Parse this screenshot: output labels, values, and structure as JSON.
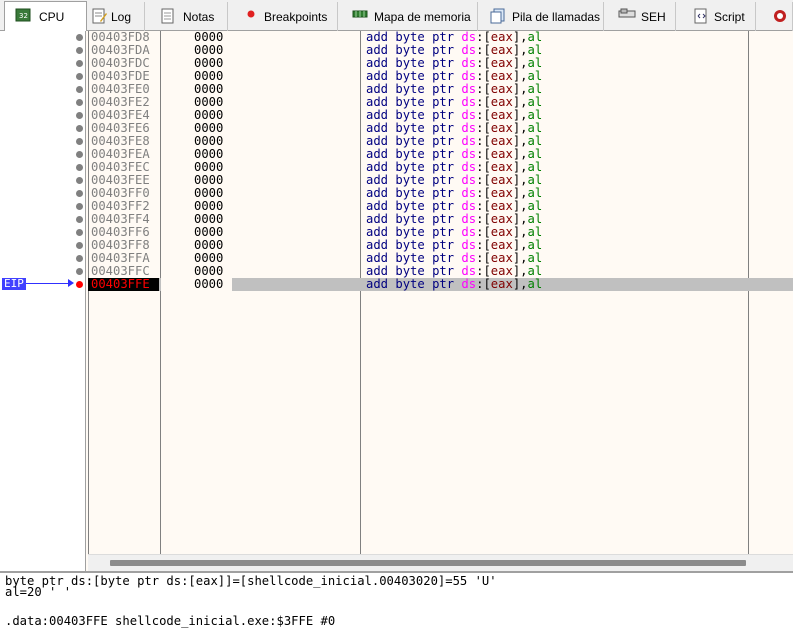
{
  "tabs": [
    {
      "label": "CPU",
      "icon": "cpu-icon",
      "active": true
    },
    {
      "label": "Log",
      "icon": "log-icon"
    },
    {
      "label": "Notas",
      "icon": "notes-icon"
    },
    {
      "label": "Breakpoints",
      "icon": "breakpoint-icon"
    },
    {
      "label": "Mapa de memoria",
      "icon": "memory-map-icon"
    },
    {
      "label": "Pila de llamadas",
      "icon": "call-stack-icon"
    },
    {
      "label": "SEH",
      "icon": "seh-icon"
    },
    {
      "label": "Script",
      "icon": "script-icon"
    }
  ],
  "eip_label": "EIP",
  "disasm": {
    "mnemonic": "add",
    "size": "byte",
    "ptr": "ptr",
    "segment": "ds",
    "reg_mem": "eax",
    "reg_src": "al",
    "rows": [
      {
        "address": "00403FD8",
        "bytes": "0000"
      },
      {
        "address": "00403FDA",
        "bytes": "0000"
      },
      {
        "address": "00403FDC",
        "bytes": "0000"
      },
      {
        "address": "00403FDE",
        "bytes": "0000"
      },
      {
        "address": "00403FE0",
        "bytes": "0000"
      },
      {
        "address": "00403FE2",
        "bytes": "0000"
      },
      {
        "address": "00403FE4",
        "bytes": "0000"
      },
      {
        "address": "00403FE6",
        "bytes": "0000"
      },
      {
        "address": "00403FE8",
        "bytes": "0000"
      },
      {
        "address": "00403FEA",
        "bytes": "0000"
      },
      {
        "address": "00403FEC",
        "bytes": "0000"
      },
      {
        "address": "00403FEE",
        "bytes": "0000"
      },
      {
        "address": "00403FF0",
        "bytes": "0000"
      },
      {
        "address": "00403FF2",
        "bytes": "0000"
      },
      {
        "address": "00403FF4",
        "bytes": "0000"
      },
      {
        "address": "00403FF6",
        "bytes": "0000"
      },
      {
        "address": "00403FF8",
        "bytes": "0000"
      },
      {
        "address": "00403FFA",
        "bytes": "0000"
      },
      {
        "address": "00403FFC",
        "bytes": "0000"
      },
      {
        "address": "00403FFE",
        "bytes": "0000",
        "current": true
      }
    ]
  },
  "info": {
    "line1": "byte ptr ds:[byte ptr ds:[eax]]=[shellcode_inicial.00403020]=55 'U'",
    "line2": "al=20 ' '",
    "line3": "",
    "line4": ".data:00403FFE shellcode_inicial.exe:$3FFE #0"
  }
}
